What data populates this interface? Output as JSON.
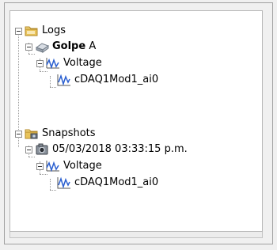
{
  "tree": {
    "logs": {
      "label": "Logs",
      "icon": "folder-icon",
      "children": [
        {
          "label_bold": "Golpe",
          "label_rest": " A",
          "icon": "disk-icon",
          "signal": {
            "label": "Voltage",
            "icon": "waveform-icon",
            "channel": {
              "label": "cDAQ1Mod1_ai0",
              "icon": "channel-waveform-icon"
            }
          }
        }
      ]
    },
    "snapshots": {
      "label": "Snapshots",
      "icon": "camera-folder-icon",
      "children": [
        {
          "label": "05/03/2018 03:33:15 p.m.",
          "icon": "camera-icon",
          "signal": {
            "label": "Voltage",
            "icon": "waveform-icon",
            "channel": {
              "label": "cDAQ1Mod1_ai0",
              "icon": "channel-waveform-icon"
            }
          }
        }
      ]
    }
  },
  "colors": {
    "folder": "#e8c35a",
    "wave": "#2a5fd0",
    "selection_focus": "#dfe8f7"
  }
}
